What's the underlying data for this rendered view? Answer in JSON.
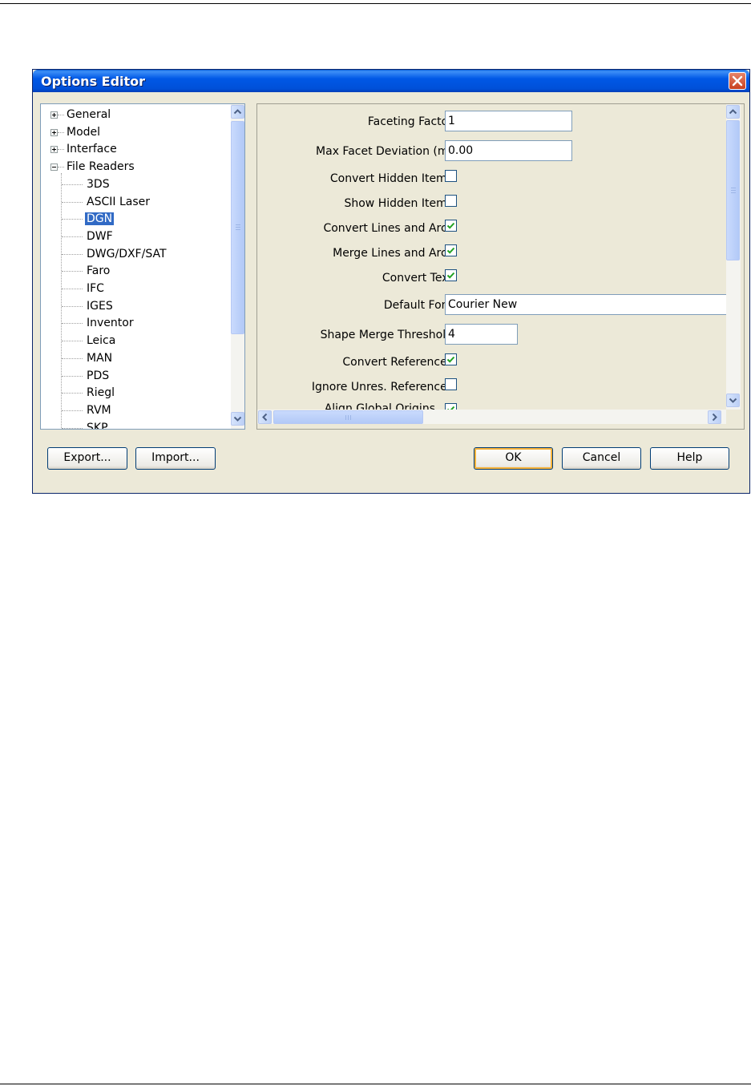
{
  "window": {
    "title": "Options Editor"
  },
  "tree": {
    "items": [
      {
        "label": "General"
      },
      {
        "label": "Model"
      },
      {
        "label": "Interface"
      },
      {
        "label": "File Readers"
      },
      {
        "label": "3DS"
      },
      {
        "label": "ASCII Laser"
      },
      {
        "label": "DGN"
      },
      {
        "label": "DWF"
      },
      {
        "label": "DWG/DXF/SAT"
      },
      {
        "label": "Faro"
      },
      {
        "label": "IFC"
      },
      {
        "label": "IGES"
      },
      {
        "label": "Inventor"
      },
      {
        "label": "Leica"
      },
      {
        "label": "MAN"
      },
      {
        "label": "PDS"
      },
      {
        "label": "Riegl"
      },
      {
        "label": "RVM"
      },
      {
        "label": "SKP"
      }
    ],
    "selected": "DGN"
  },
  "settings": {
    "faceting_factor": {
      "label": "Faceting Factor",
      "value": "1"
    },
    "max_facet_deviation": {
      "label": "Max Facet Deviation (m)",
      "value": "0.00"
    },
    "convert_hidden_items": {
      "label": "Convert Hidden Items",
      "checked": false
    },
    "show_hidden_items": {
      "label": "Show Hidden Items",
      "checked": false
    },
    "convert_lines_arcs": {
      "label": "Convert Lines and Arcs",
      "checked": true
    },
    "merge_lines_arcs": {
      "label": "Merge Lines and Arcs",
      "checked": true
    },
    "convert_text": {
      "label": "Convert Text",
      "checked": true
    },
    "default_font": {
      "label": "Default Font",
      "value": "Courier New"
    },
    "shape_merge_threshold": {
      "label": "Shape Merge Threshold",
      "value": "4"
    },
    "convert_references": {
      "label": "Convert References",
      "checked": true
    },
    "ignore_unres_references": {
      "label": "Ignore Unres. References",
      "checked": false
    },
    "align_global_origins": {
      "label": "Align Global Origins",
      "checked": true
    }
  },
  "buttons": {
    "export": "Export...",
    "import": "Import...",
    "ok": "OK",
    "cancel": "Cancel",
    "help": "Help"
  },
  "colors": {
    "title_bar": "#0058e6",
    "selection": "#316ac5",
    "check": "#21a121"
  }
}
